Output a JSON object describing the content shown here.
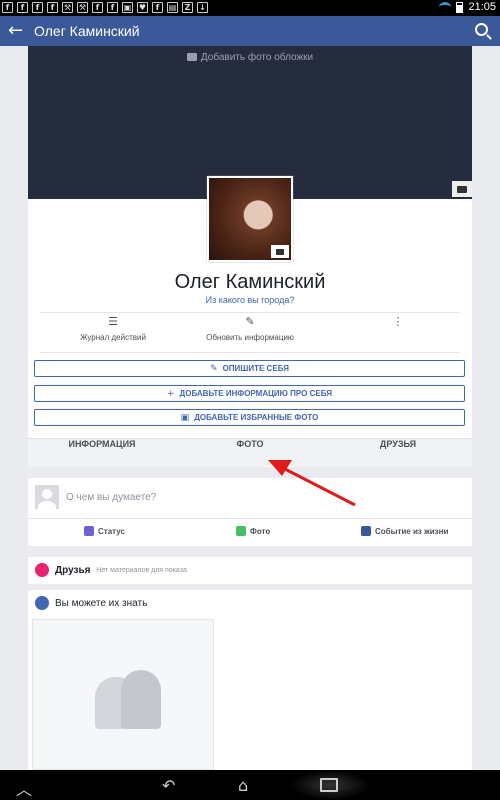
{
  "status_bar": {
    "icons": [
      "f",
      "f",
      "f",
      "f",
      "tools",
      "tools",
      "f",
      "f",
      "image",
      "heart",
      "f",
      "file",
      "z",
      "download"
    ],
    "time": "21:05"
  },
  "app_bar": {
    "back_icon": "arrow-left-icon",
    "title": "Олег Каминский",
    "search_icon": "search-icon"
  },
  "profile": {
    "cover_label": "Добавить фото обложки",
    "name": "Олег Каминский",
    "city_prompt": "Из какого вы города?",
    "actions": [
      {
        "label": "Журнал действий",
        "icon": "list-icon"
      },
      {
        "label": "Обновить информацию",
        "icon": "person-edit-icon"
      },
      {
        "label": "",
        "icon": "more-vertical-icon"
      }
    ],
    "buttons": [
      {
        "label": "ОПИШИТЕ СЕБЯ",
        "icon": "pencil-icon"
      },
      {
        "label": "ДОБАВЬТЕ ИНФОРМАЦИЮ ПРО СЕБЯ",
        "icon": "plus-icon"
      },
      {
        "label": "ДОБАВЬТЕ ИЗБРАННЫЕ ФОТО",
        "icon": "photo-icon"
      }
    ],
    "tabs": [
      "ИНФОРМАЦИЯ",
      "ФОТО",
      "ДРУЗЬЯ"
    ]
  },
  "composer": {
    "prompt": "О чем вы думаете?",
    "actions": [
      {
        "label": "Статус",
        "color": "#6d5fd6"
      },
      {
        "label": "Фото",
        "color": "#45bd62"
      },
      {
        "label": "Событие из жизни",
        "color": "#3b5998"
      }
    ]
  },
  "friends": {
    "title": "Друзья",
    "subtitle": "· Нет материалов для показа"
  },
  "pymk": {
    "title": "Вы можете их знать"
  },
  "colors": {
    "brand": "#3b5998",
    "link": "#4267b2",
    "annotation_arrow": "#e01b1b"
  }
}
